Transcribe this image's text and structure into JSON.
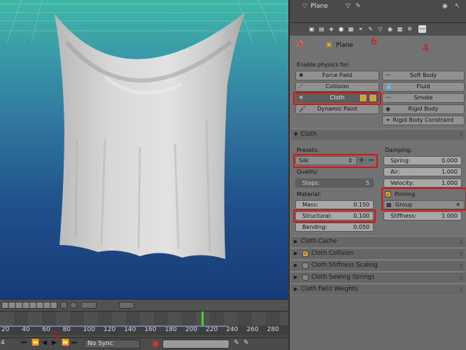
{
  "viewport": {
    "frame": "4"
  },
  "timeline": {
    "ticks": [
      "20",
      "40",
      "60",
      "80",
      "100",
      "120",
      "140",
      "160",
      "180",
      "200",
      "220",
      "240",
      "260",
      "280"
    ],
    "playhead_frame": 236
  },
  "playbar": {
    "sync": "No Sync",
    "callout": "5"
  },
  "props_header": {
    "object": "Plane"
  },
  "tabs_callout": "4",
  "object_row": {
    "name": "Plane",
    "callout": "6"
  },
  "physics": {
    "title": "Enable physics for:",
    "left": [
      "Force Field",
      "Collision",
      "Cloth",
      "Dynamic Paint"
    ],
    "right": [
      "Soft Body",
      "Fluid",
      "Smoke",
      "Rigid Body",
      "Rigid Body Constraint"
    ]
  },
  "cloth": {
    "title": "Cloth",
    "presets_label": "Presets:",
    "preset": "Silk",
    "quality_label": "Quality:",
    "steps": {
      "label": "Steps:",
      "value": "5"
    },
    "material_label": "Material:",
    "mass": {
      "label": "Mass:",
      "value": "0.150"
    },
    "structural": {
      "label": "Structural:",
      "value": "0.100"
    },
    "bending": {
      "label": "Bending:",
      "value": "0.050"
    },
    "damping_label": "Damping:",
    "spring": {
      "label": "Spring:",
      "value": "0.000"
    },
    "air": {
      "label": "Air:",
      "value": "1.000"
    },
    "velocity": {
      "label": "Velocity:",
      "value": "1.000"
    },
    "pinning": "Pinning",
    "group": "Group",
    "stiffness": {
      "label": "Stiffness:",
      "value": "1.000"
    }
  },
  "subpanels": [
    "Cloth Cache",
    "Cloth Collision",
    "Cloth Stiffness Scaling",
    "Cloth Sewing Springs",
    "Cloth Field Weights"
  ]
}
